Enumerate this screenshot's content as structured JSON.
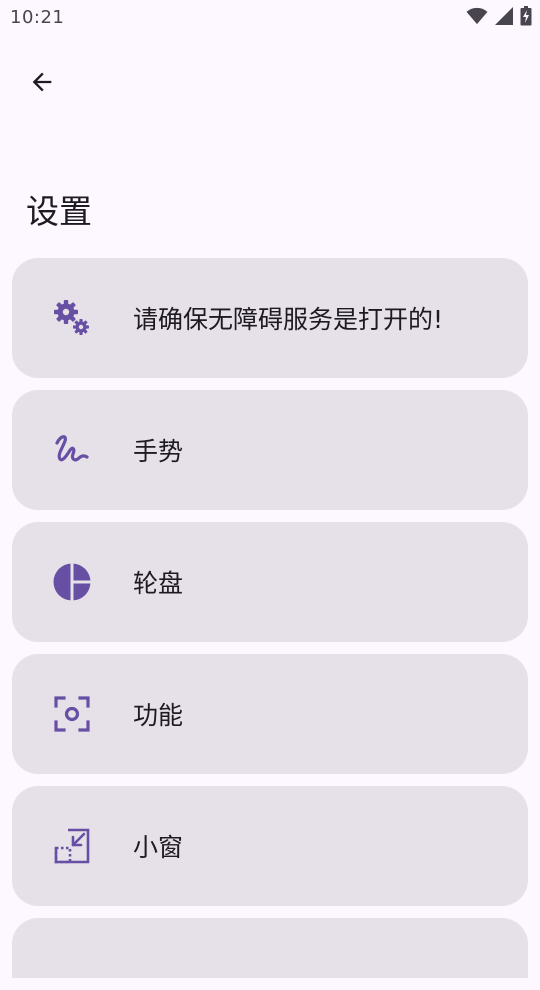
{
  "status_bar": {
    "time": "10:21",
    "icons": [
      "wifi-icon",
      "signal-icon",
      "battery-charging-icon"
    ]
  },
  "header": {
    "back_icon": "arrow-back-icon"
  },
  "page": {
    "title": "设置"
  },
  "colors": {
    "background": "#fdf7ff",
    "card": "#e6e0e9",
    "accent": "#6750a4",
    "text": "#1d1b20"
  },
  "settings": {
    "items": [
      {
        "label": "请确保无障碍服务是打开的!",
        "icon": "gears-icon"
      },
      {
        "label": "手势",
        "icon": "gesture-icon"
      },
      {
        "label": "轮盘",
        "icon": "pie-chart-icon"
      },
      {
        "label": "功能",
        "icon": "center-focus-icon"
      },
      {
        "label": "小窗",
        "icon": "picture-in-picture-icon"
      }
    ]
  }
}
